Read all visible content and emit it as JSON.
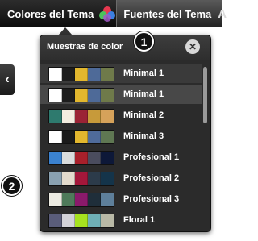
{
  "toolbar": {
    "colors_label": "Colores del Tema",
    "fonts_label": "Fuentes del Tema",
    "fonts_icon_glyph": "A"
  },
  "side_tab": {
    "glyph": "‹"
  },
  "callouts": [
    "1",
    "2"
  ],
  "popup": {
    "title": "Muestras de color",
    "close_glyph": "✕",
    "themes": [
      {
        "name": "Minimal 1",
        "colors": [
          "#ffffff",
          "#1d1d1d",
          "#e2b72e",
          "#4e6a98",
          "#6f7a4a"
        ],
        "state": "hover"
      },
      {
        "name": "Minimal 1",
        "colors": [
          "#ffffff",
          "#1d1d1d",
          "#e2b72e",
          "#4e6a98",
          "#6f7a4a"
        ],
        "state": "selected"
      },
      {
        "name": "Minimal 2",
        "colors": [
          "#2e7a6e",
          "#f3ede0",
          "#9b2335",
          "#c79a3a",
          "#d6a25a"
        ],
        "state": "normal"
      },
      {
        "name": "Minimal 3",
        "colors": [
          "#ffffff",
          "#1a1a1a",
          "#e2b72e",
          "#4f6b9a",
          "#5f7752"
        ],
        "state": "normal"
      },
      {
        "name": "Profesional 1",
        "colors": [
          "#3b82cf",
          "#d9dcdd",
          "#a8202b",
          "#4a4c5e",
          "#0d1838"
        ],
        "state": "normal"
      },
      {
        "name": "Profesional 2",
        "colors": [
          "#8aa1b1",
          "#e3dbcd",
          "#a3173a",
          "#2c3b4a",
          "#14344a"
        ],
        "state": "normal"
      },
      {
        "name": "Profesional 3",
        "colors": [
          "#ecebe2",
          "#4e7a5a",
          "#8b1a6b",
          "#1f2e3a",
          "#5e7f9a"
        ],
        "state": "normal"
      },
      {
        "name": "Floral 1",
        "colors": [
          "#5a5d7a",
          "#d3d2d8",
          "#a6e21f",
          "#6fb0b6",
          "#b9b9a6"
        ],
        "state": "normal"
      }
    ]
  }
}
